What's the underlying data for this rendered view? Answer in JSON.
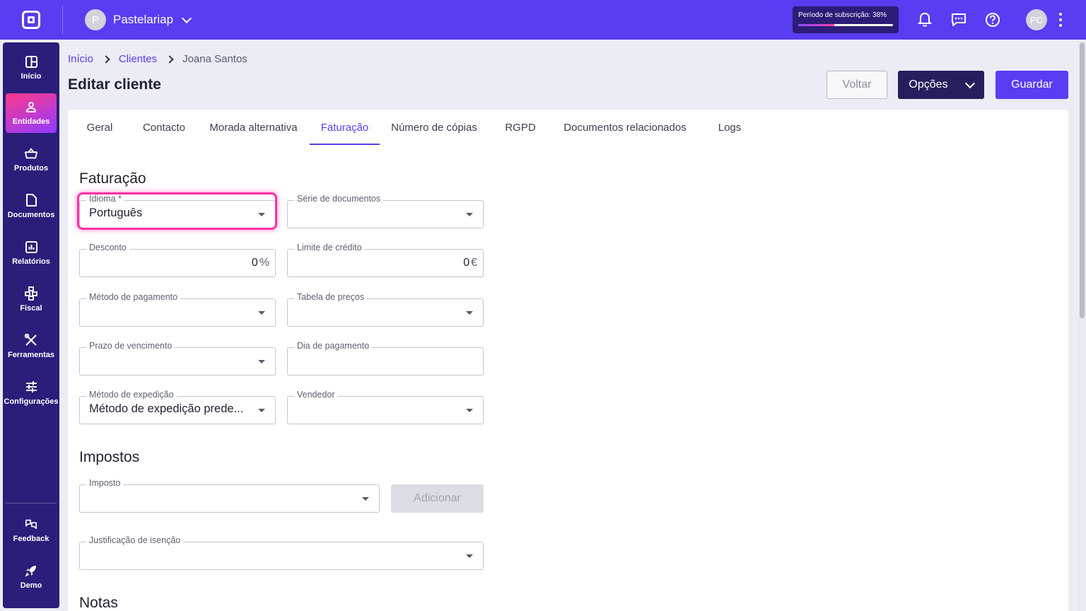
{
  "topbar": {
    "company_initial": "P",
    "company_name": "Pastelariap",
    "subscription_label": "Período de subscrição: 38%",
    "subscription_percent": 38,
    "user_initials": "PC",
    "icons": [
      "bell-icon",
      "chat-icon",
      "help-icon"
    ]
  },
  "sidebar": {
    "items": [
      {
        "label": "Início",
        "icon": "grid-icon"
      },
      {
        "label": "Entidades",
        "icon": "person-icon",
        "active": true
      },
      {
        "label": "Produtos",
        "icon": "basket-icon"
      },
      {
        "label": "Documentos",
        "icon": "document-icon"
      },
      {
        "label": "Relatórios",
        "icon": "report-icon"
      },
      {
        "label": "Fiscal",
        "icon": "fiscal-icon"
      },
      {
        "label": "Ferramentas",
        "icon": "tools-icon"
      },
      {
        "label": "Configurações",
        "icon": "sliders-icon"
      },
      {
        "label": "Feedback",
        "icon": "feedback-icon"
      },
      {
        "label": "Demo",
        "icon": "rocket-icon"
      }
    ]
  },
  "breadcrumb": {
    "items": [
      "Início",
      "Clientes",
      "Joana Santos"
    ]
  },
  "page": {
    "title": "Editar cliente",
    "back_label": "Voltar",
    "options_label": "Opções",
    "save_label": "Guardar"
  },
  "tabs": [
    "Geral",
    "Contacto",
    "Morada alternativa",
    "Faturação",
    "Número de cópias",
    "RGPD",
    "Documentos relacionados",
    "Logs"
  ],
  "active_tab": "Faturação",
  "billing": {
    "section_title": "Faturação",
    "language": {
      "label": "Idioma *",
      "value": "Português"
    },
    "document_series": {
      "label": "Série de documentos",
      "value": ""
    },
    "discount": {
      "label": "Desconto",
      "value": "0",
      "unit": "%"
    },
    "credit_limit": {
      "label": "Limite de crédito",
      "value": "0",
      "unit": "€"
    },
    "payment_method": {
      "label": "Método de pagamento",
      "value": ""
    },
    "price_table": {
      "label": "Tabela de preços",
      "value": ""
    },
    "due_term": {
      "label": "Prazo de vencimento",
      "value": ""
    },
    "payment_day": {
      "label": "Dia de pagamento",
      "value": ""
    },
    "shipping_method": {
      "label": "Método de expedição",
      "value": "Método de expedição prede..."
    },
    "seller": {
      "label": "Vendedor",
      "value": ""
    }
  },
  "taxes": {
    "section_title": "Impostos",
    "tax": {
      "label": "Imposto",
      "value": ""
    },
    "add_label": "Adicionar",
    "exemption": {
      "label": "Justificação de isenção",
      "value": ""
    }
  },
  "notes": {
    "section_title": "Notas"
  }
}
